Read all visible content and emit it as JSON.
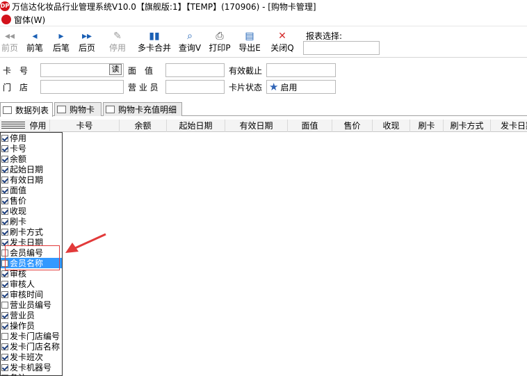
{
  "window": {
    "title": "万信达化妆品行业管理系统V10.0【旗舰版:1】【TEMP】(170906) - [购物卡管理]"
  },
  "menubar": {
    "item": "窗体(W)"
  },
  "toolbar": {
    "buttons": [
      {
        "label": "前页",
        "icon": "double-left-icon",
        "enabled": false
      },
      {
        "label": "前笔",
        "icon": "left-icon",
        "enabled": true
      },
      {
        "label": "后笔",
        "icon": "right-icon",
        "enabled": true
      },
      {
        "label": "后页",
        "icon": "double-right-icon",
        "enabled": true
      },
      {
        "label": "停用",
        "icon": "disable-icon",
        "enabled": false
      },
      {
        "label": "多卡合并",
        "icon": "merge-icon",
        "enabled": true
      },
      {
        "label": "查询V",
        "icon": "query-icon",
        "enabled": true
      },
      {
        "label": "打印P",
        "icon": "print-icon",
        "enabled": true
      },
      {
        "label": "导出E",
        "icon": "export-icon",
        "enabled": true
      },
      {
        "label": "关闭Q",
        "icon": "close-icon",
        "enabled": true
      }
    ],
    "report_select_label": "报表选择:"
  },
  "filters": {
    "card_label": "卡　号",
    "read_button": "读",
    "store_label": "门　店",
    "face_value_label": "面　值",
    "salesperson_label": "营 业 员",
    "expiry_label": "有效截止",
    "card_status_label": "卡片状态",
    "card_status_value": "启用"
  },
  "tabs": [
    "数据列表",
    "购物卡",
    "购物卡充值明细"
  ],
  "grid": {
    "columns": [
      "停用",
      "卡号",
      "余额",
      "起始日期",
      "有效日期",
      "面值",
      "售价",
      "收现",
      "刷卡",
      "刷卡方式",
      "发卡日期"
    ]
  },
  "column_chooser": {
    "items": [
      {
        "label": "停用",
        "checked": true
      },
      {
        "label": "卡号",
        "checked": true
      },
      {
        "label": "余额",
        "checked": true
      },
      {
        "label": "起始日期",
        "checked": true
      },
      {
        "label": "有效日期",
        "checked": true
      },
      {
        "label": "面值",
        "checked": true
      },
      {
        "label": "售价",
        "checked": true
      },
      {
        "label": "收现",
        "checked": true
      },
      {
        "label": "刷卡",
        "checked": true
      },
      {
        "label": "刷卡方式",
        "checked": true
      },
      {
        "label": "发卡日期",
        "checked": true
      },
      {
        "label": "会员编号",
        "checked": false
      },
      {
        "label": "会员名称",
        "checked": false,
        "highlighted": true
      },
      {
        "label": "审核",
        "checked": true
      },
      {
        "label": "审核人",
        "checked": true
      },
      {
        "label": "审核时间",
        "checked": true
      },
      {
        "label": "营业员编号",
        "checked": false
      },
      {
        "label": "营业员",
        "checked": true
      },
      {
        "label": "操作员",
        "checked": true
      },
      {
        "label": "发卡门店编号",
        "checked": false
      },
      {
        "label": "发卡门店名称",
        "checked": true
      },
      {
        "label": "发卡班次",
        "checked": true
      },
      {
        "label": "发卡机器号",
        "checked": true
      },
      {
        "label": "备注",
        "checked": true
      }
    ]
  },
  "colors": {
    "highlight": "#3399ff",
    "annotation": "#e23a3a",
    "icon_blue": "#1a5fb4"
  }
}
